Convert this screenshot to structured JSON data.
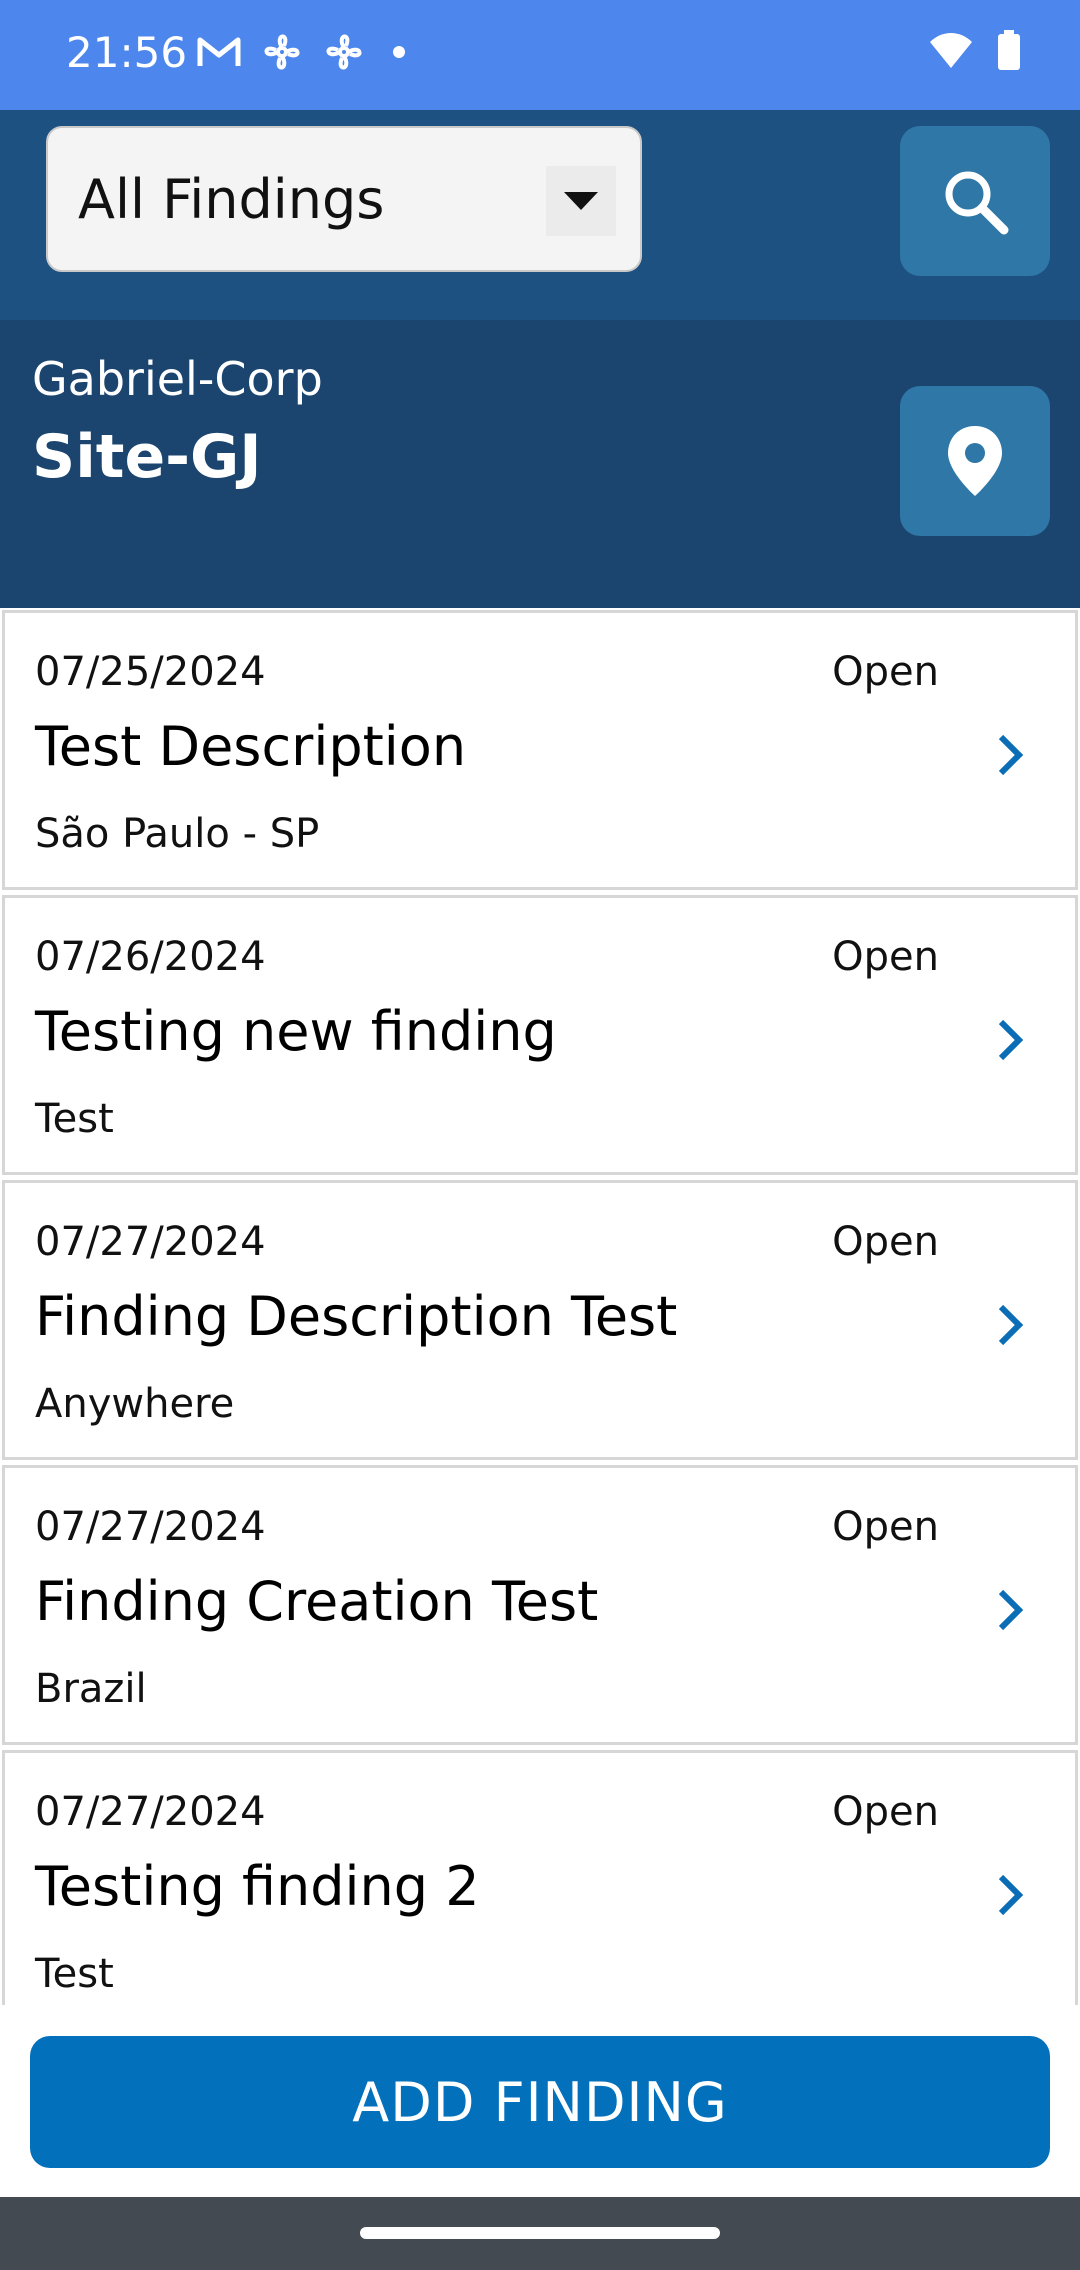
{
  "status_bar": {
    "time": "21:56",
    "left_icons": [
      "gmail-icon",
      "fan-icon",
      "fan-icon",
      "dot-icon"
    ],
    "right_icons": [
      "wifi-icon",
      "battery-icon"
    ]
  },
  "toolbar": {
    "filter_value": "All Findings",
    "search_icon": "search-icon"
  },
  "site": {
    "company": "Gabriel-Corp",
    "name": "Site-GJ",
    "location_icon": "location-pin-icon"
  },
  "findings": [
    {
      "date": "07/25/2024",
      "status": "Open",
      "title": "Test Description",
      "location": "São Paulo - SP"
    },
    {
      "date": "07/26/2024",
      "status": "Open",
      "title": "Testing new finding",
      "location": "Test"
    },
    {
      "date": "07/27/2024",
      "status": "Open",
      "title": "Finding Description Test",
      "location": "Anywhere"
    },
    {
      "date": "07/27/2024",
      "status": "Open",
      "title": "Finding Creation Test",
      "location": "Brazil"
    },
    {
      "date": "07/27/2024",
      "status": "Open",
      "title": "Testing finding 2",
      "location": "Test"
    }
  ],
  "actions": {
    "add_finding_label": "ADD FINDING"
  },
  "colors": {
    "status_bar": "#4d87ee",
    "toolbar": "#1d5181",
    "site_header": "#1b456e",
    "icon_button": "#2e77a6",
    "primary_button": "#0370bc",
    "chevron": "#0a6db5",
    "nav_bar": "#434a52"
  }
}
